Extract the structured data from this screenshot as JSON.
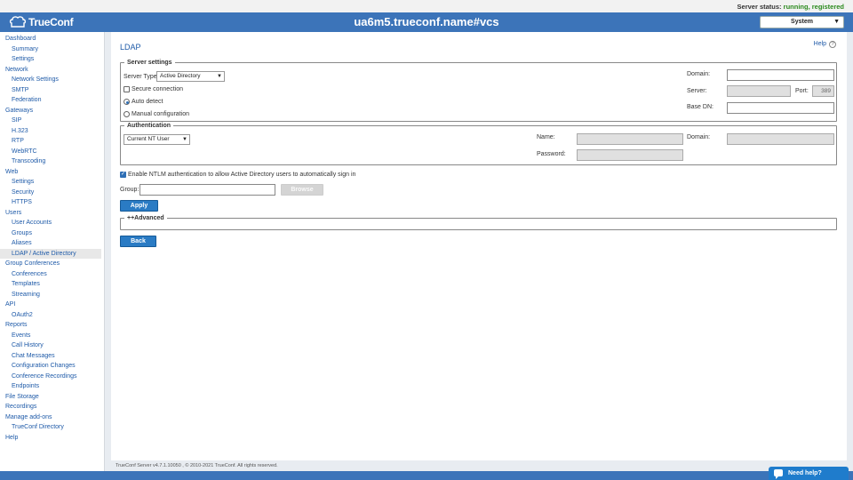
{
  "status": {
    "label": "Server status:",
    "value": "running, registered"
  },
  "header": {
    "logo_text": "TrueConf",
    "host": "ua6m5.trueconf.name#vcs",
    "system_select": "System"
  },
  "sidebar": {
    "items": [
      {
        "label": "Dashboard",
        "level": 0
      },
      {
        "label": "Summary",
        "level": 1
      },
      {
        "label": "Settings",
        "level": 1
      },
      {
        "label": "Network",
        "level": 0
      },
      {
        "label": "Network Settings",
        "level": 1
      },
      {
        "label": "SMTP",
        "level": 1
      },
      {
        "label": "Federation",
        "level": 1
      },
      {
        "label": "Gateways",
        "level": 0
      },
      {
        "label": "SIP",
        "level": 1
      },
      {
        "label": "H.323",
        "level": 1
      },
      {
        "label": "RTP",
        "level": 1
      },
      {
        "label": "WebRTC",
        "level": 1
      },
      {
        "label": "Transcoding",
        "level": 1
      },
      {
        "label": "Web",
        "level": 0
      },
      {
        "label": "Settings",
        "level": 1
      },
      {
        "label": "Security",
        "level": 1
      },
      {
        "label": "HTTPS",
        "level": 1
      },
      {
        "label": "Users",
        "level": 0
      },
      {
        "label": "User Accounts",
        "level": 1
      },
      {
        "label": "Groups",
        "level": 1
      },
      {
        "label": "Aliases",
        "level": 1
      },
      {
        "label": "LDAP / Active Directory",
        "level": 1,
        "active": true
      },
      {
        "label": "Group Conferences",
        "level": 0
      },
      {
        "label": "Conferences",
        "level": 1
      },
      {
        "label": "Templates",
        "level": 1
      },
      {
        "label": "Streaming",
        "level": 1
      },
      {
        "label": "API",
        "level": 0
      },
      {
        "label": "OAuth2",
        "level": 1
      },
      {
        "label": "Reports",
        "level": 0
      },
      {
        "label": "Events",
        "level": 1
      },
      {
        "label": "Call History",
        "level": 1
      },
      {
        "label": "Chat Messages",
        "level": 1
      },
      {
        "label": "Configuration Changes",
        "level": 1
      },
      {
        "label": "Conference Recordings",
        "level": 1
      },
      {
        "label": "Endpoints",
        "level": 1
      },
      {
        "label": "File Storage",
        "level": 0
      },
      {
        "label": "Recordings",
        "level": 0
      },
      {
        "label": "Manage add-ons",
        "level": 0
      },
      {
        "label": "TrueConf Directory",
        "level": 1
      },
      {
        "label": "Help",
        "level": 0
      }
    ]
  },
  "main": {
    "title": "LDAP",
    "help": "Help",
    "server_settings": {
      "legend": "Server settings",
      "server_type_label": "Server Type:",
      "server_type_value": "Active Directory",
      "secure_connection": "Secure connection",
      "auto_detect": "Auto detect",
      "manual_config": "Manual configuration",
      "domain_label": "Domain:",
      "domain_value": "",
      "server_label": "Server:",
      "server_value": "",
      "port_label": "Port:",
      "port_value": "389",
      "base_dn_label": "Base DN:",
      "base_dn_value": ""
    },
    "authentication": {
      "legend": "Authentication",
      "mode_value": "Current NT User",
      "name_label": "Name:",
      "domain_label": "Domain:",
      "password_label": "Password:"
    },
    "ntlm_label": "Enable NTLM authentication to allow Active Directory users to automatically sign in",
    "ntlm_checked": true,
    "group_label": "Group:",
    "group_value": "",
    "browse_button": "Browse",
    "apply_button": "Apply",
    "advanced_legend": "++Advanced",
    "back_button": "Back"
  },
  "footer": {
    "text": "TrueConf Server v4.7.1.10050 , © 2010-2021 TrueConf. All rights reserved."
  },
  "chat_widget": {
    "label": "Need help?"
  },
  "colors": {
    "header": "#3c74b9",
    "link": "#1e5aa8",
    "button": "#2a7bc4",
    "status_ok": "#2b8a1e"
  }
}
